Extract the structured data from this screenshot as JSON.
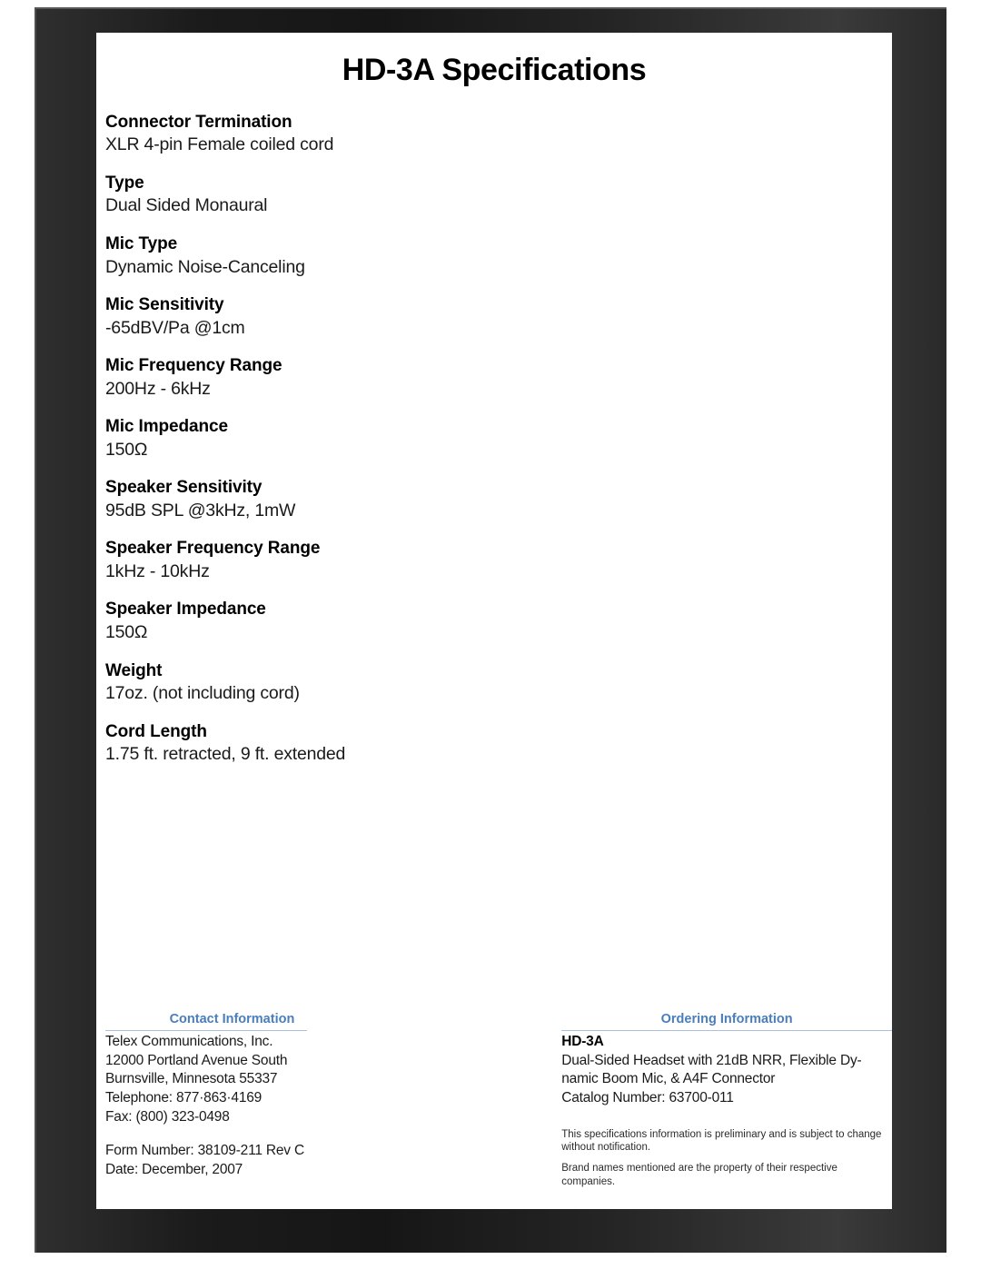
{
  "document": {
    "title": "HD-3A Specifications"
  },
  "specs": [
    {
      "label": "Connector Termination",
      "value": "XLR 4-pin Female coiled cord"
    },
    {
      "label": "Type",
      "value": "Dual Sided Monaural"
    },
    {
      "label": "Mic Type",
      "value": "Dynamic Noise-Canceling"
    },
    {
      "label": "Mic Sensitivity",
      "value": "-65dBV/Pa @1cm"
    },
    {
      "label": "Mic Frequency Range",
      "value": "200Hz - 6kHz"
    },
    {
      "label": "Mic Impedance",
      "value": "150Ω"
    },
    {
      "label": "Speaker Sensitivity",
      "value": "95dB SPL @3kHz, 1mW"
    },
    {
      "label": "Speaker Frequency Range",
      "value": "1kHz - 10kHz"
    },
    {
      "label": "Speaker Impedance",
      "value": "150Ω"
    },
    {
      "label": "Weight",
      "value": "17oz. (not including cord)"
    },
    {
      "label": "Cord Length",
      "value": "1.75 ft. retracted, 9 ft. extended"
    }
  ],
  "contact": {
    "heading": "Contact Information",
    "company": "Telex Communications, Inc.",
    "address_line1": "12000 Portland Avenue South",
    "address_line2": "Burnsville, Minnesota 55337",
    "telephone": "Telephone: 877·863·4169",
    "fax": "Fax: (800) 323-0498",
    "form_number": "Form Number: 38109-211 Rev C",
    "date": "Date: December, 2007"
  },
  "ordering": {
    "heading": "Ordering Information",
    "model": "HD-3A",
    "description_line1": "Dual-Sided Headset with 21dB NRR, Flexible Dy-",
    "description_line2": "namic Boom Mic, & A4F Connector",
    "catalog_number": "Catalog Number: 63700-011"
  },
  "disclaimer": {
    "line1": "This specifications information is preliminary and is subject to change without notification.",
    "line2": "Brand names mentioned are the property of their respective companies."
  },
  "colors": {
    "heading_blue": "#4a7ebb",
    "rule_blue": "#aebfd8",
    "frame_dark": "#1b1b1b"
  }
}
